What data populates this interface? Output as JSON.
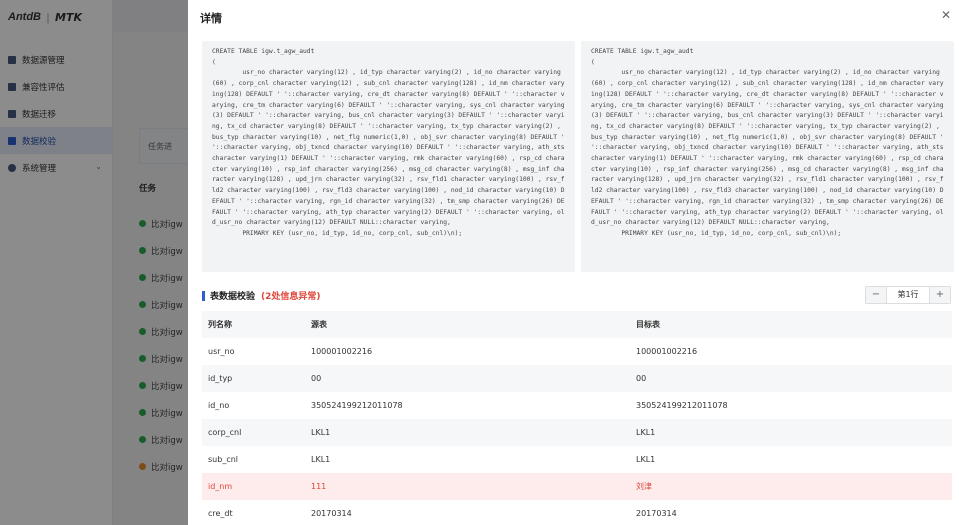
{
  "brand": {
    "logo": "AntdB",
    "product": "MTK"
  },
  "sidebar": {
    "items": [
      {
        "label": "数据源管理",
        "icon": "database-icon"
      },
      {
        "label": "兼容性评估",
        "icon": "document-icon"
      },
      {
        "label": "数据迁移",
        "icon": "folder-icon"
      },
      {
        "label": "数据校验",
        "icon": "check-doc-icon"
      },
      {
        "label": "系统管理",
        "icon": "gear-icon"
      }
    ]
  },
  "background": {
    "tip": "任务进",
    "tasks_header": "任务",
    "tasks": [
      "比对igw",
      "比对igw",
      "比对igw",
      "比对igw",
      "比对igw",
      "比对igw",
      "比对igw",
      "比对igw",
      "比对igw",
      "比对igw"
    ]
  },
  "drawer": {
    "title": "详情",
    "close_icon": "close-icon",
    "sql_source": "CREATE TABLE igw.t_agw_audt\n(\n        usr_no character varying(12) , id_typ character varying(2) , id_no character varying(60) , corp_cnl character varying(12) , sub_cnl character varying(128) , id_nm character varying(128) DEFAULT ' '::character varying, cre_dt character varying(8) DEFAULT ' '::character varying, cre_tm character varying(6) DEFAULT ' '::character varying, sys_cnl character varying(3) DEFAULT ' '::character varying, bus_cnl character varying(3) DEFAULT ' '::character varying, tx_cd character varying(8) DEFAULT ' '::character varying, tx_typ character varying(2) , bus_typ character varying(10) , net_flg numeric(1,0) , obj_svr character varying(8) DEFAULT ' '::character varying, obj_txncd character varying(10) DEFAULT ' '::character varying, ath_sts character varying(1) DEFAULT ' '::character varying, rmk character varying(60) , rsp_cd character varying(10) , rsp_inf character varying(256) , msg_cd character varying(8) , msg_inf character varying(128) , upd_jrn character varying(32) , rsv_fld1 character varying(100) , rsv_fld2 character varying(100) , rsv_fld3 character varying(100) , nod_id character varying(10) DEFAULT ' '::character varying, rgn_id character varying(32) , tm_smp character varying(26) DEFAULT ' '::character varying, ath_typ character varying(2) DEFAULT ' '::character varying, old_usr_no character varying(12) DEFAULT NULL::character varying,\n        PRIMARY KEY (usr_no, id_typ, id_no, corp_cnl, sub_cnl)\\n);",
    "sql_target": "CREATE TABLE igw.t_agw_audt\n(\n        usr_no character varying(12) , id_typ character varying(2) , id_no character varying(60) , corp_cnl character varying(12) , sub_cnl character varying(128) , id_nm character varying(128) DEFAULT ' '::character varying, cre_dt character varying(8) DEFAULT ' '::character varying, cre_tm character varying(6) DEFAULT ' '::character varying, sys_cnl character varying(3) DEFAULT ' '::character varying, bus_cnl character varying(3) DEFAULT ' '::character varying, tx_cd character varying(8) DEFAULT ' '::character varying, tx_typ character varying(2) , bus_typ character varying(10) , net_flg numeric(1,0) , obj_svr character varying(8) DEFAULT ' '::character varying, obj_txncd character varying(10) DEFAULT ' '::character varying, ath_sts character varying(1) DEFAULT ' '::character varying, rmk character varying(60) , rsp_cd character varying(10) , rsp_inf character varying(256) , msg_cd character varying(8) , msg_inf character varying(128) , upd_jrn character varying(32) , rsv_fld1 character varying(100) , rsv_fld2 character varying(100) , rsv_fld3 character varying(100) , nod_id character varying(10) DEFAULT ' '::character varying, rgn_id character varying(32) , tm_smp character varying(26) DEFAULT ' '::character varying, ath_typ character varying(2) DEFAULT ' '::character varying, old_usr_no character varying(12) DEFAULT NULL::character varying,\n        PRIMARY KEY (usr_no, id_typ, id_no, corp_cnl, sub_cnl)\\n);",
    "section_title": "表数据校验",
    "section_error": "(2处信息异常)",
    "pager": {
      "prev": "−",
      "label": "第1行",
      "next": "+"
    },
    "table": {
      "headers": [
        "列名称",
        "源表",
        "目标表"
      ],
      "rows": [
        {
          "col": "usr_no",
          "src": "100001002216",
          "dst": "100001002216",
          "error": false
        },
        {
          "col": "id_typ",
          "src": "00",
          "dst": "00",
          "error": false
        },
        {
          "col": "id_no",
          "src": "350524199212011078",
          "dst": "350524199212011078",
          "error": false
        },
        {
          "col": "corp_cnl",
          "src": "LKL1",
          "dst": "LKL1",
          "error": false
        },
        {
          "col": "sub_cnl",
          "src": "LKL1",
          "dst": "LKL1",
          "error": false
        },
        {
          "col": "id_nm",
          "src": "111",
          "dst": "刘津",
          "error": true
        },
        {
          "col": "cre_dt",
          "src": "20170314",
          "dst": "20170314",
          "error": false
        }
      ]
    }
  },
  "colors": {
    "accent": "#2f5ccf",
    "error": "#e0463a",
    "error_bg": "#fdeceb",
    "success": "#2fa84f",
    "warning": "#e38c2a"
  }
}
